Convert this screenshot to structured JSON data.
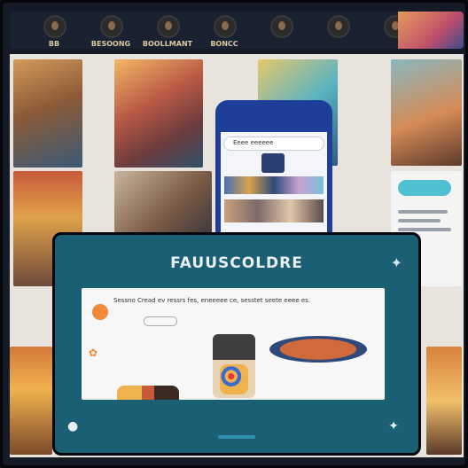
{
  "topbar": {
    "items": [
      {
        "label": "BB"
      },
      {
        "label": "BESOONG"
      },
      {
        "label": "BOOLLMANT"
      },
      {
        "label": "BONCC"
      },
      {
        "label": ""
      },
      {
        "label": ""
      },
      {
        "label": ""
      }
    ]
  },
  "phone": {
    "search_text": "Eeee eeeeee"
  },
  "modal": {
    "title": "FAUUSCOLDRE",
    "message": "Sessno Cread ev ressrs fes, eneeeee ce, sesstet seete eeee es."
  },
  "colors": {
    "modal_bg": "#1a5f73",
    "accent": "#f08a3a",
    "phone": "#1d3f9a"
  },
  "icons": {
    "sparkle_top": "sparkle-icon",
    "sparkle_bottom": "sparkle-icon",
    "left_footer": "user-icon"
  }
}
